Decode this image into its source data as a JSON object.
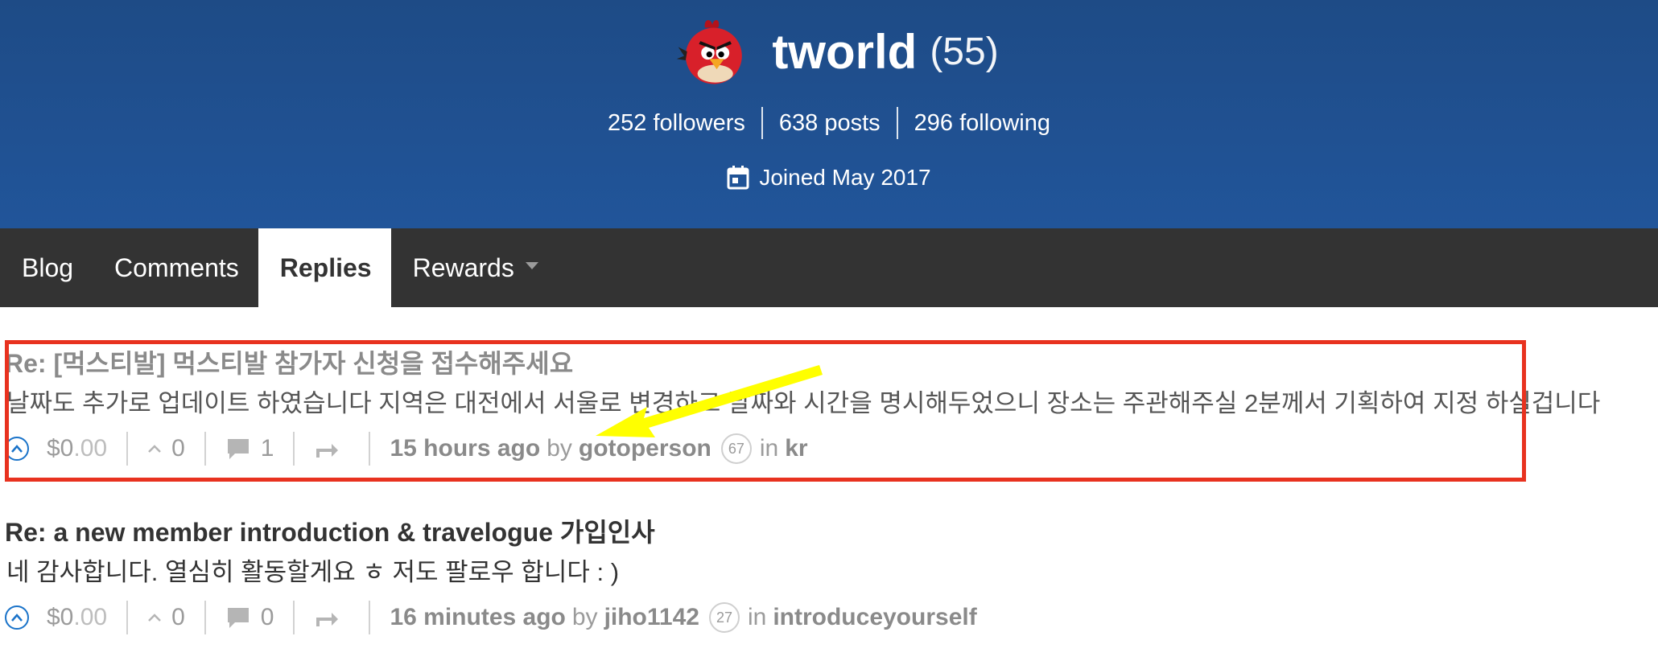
{
  "profile": {
    "username": "tworld",
    "reputation": "(55)",
    "followers": "252 followers",
    "posts": "638 posts",
    "following": "296 following",
    "joined": "Joined May 2017",
    "avatar_icon": "angry-bird-avatar",
    "calendar_icon": "calendar-icon"
  },
  "tabs": [
    {
      "label": "Blog",
      "active": false
    },
    {
      "label": "Comments",
      "active": false
    },
    {
      "label": "Replies",
      "active": true
    },
    {
      "label": "Rewards",
      "active": false,
      "has_dropdown": true
    }
  ],
  "posts": [
    {
      "title": "Re: [먹스티발] 먹스티발 참가자 신청을 접수해주세요",
      "body": "날짜도 추가로 업데이트 하였습니다 지역은 대전에서 서울로 변경하고 날짜와 시간을 명시해두었으니 장소는 주관해주실 2분께서 기획하여 지정 하실겁니다",
      "payout_dollars": "$0",
      "payout_cents": ".00",
      "votes": "0",
      "comments": "1",
      "time": "15 hours ago",
      "by": "by",
      "author": "gotoperson",
      "author_rep": "67",
      "in": "in",
      "category": "kr",
      "highlighted": true
    },
    {
      "title": "Re: a new member introduction & travelogue 가입인사",
      "body": "네 감사합니다. 열심히 활동할게요 ㅎ 저도 팔로우 합니다 : )",
      "payout_dollars": "$0",
      "payout_cents": ".00",
      "votes": "0",
      "comments": "0",
      "time": "16 minutes ago",
      "by": "by",
      "author": "jiho1142",
      "author_rep": "27",
      "in": "in",
      "category": "introduceyourself",
      "highlighted": false
    }
  ],
  "colors": {
    "header_bg": "#21559a",
    "tab_bar_bg": "#333333",
    "highlight_border": "#e8321f",
    "arrow": "#ffff00",
    "vote_accent": "#1a73c9"
  }
}
